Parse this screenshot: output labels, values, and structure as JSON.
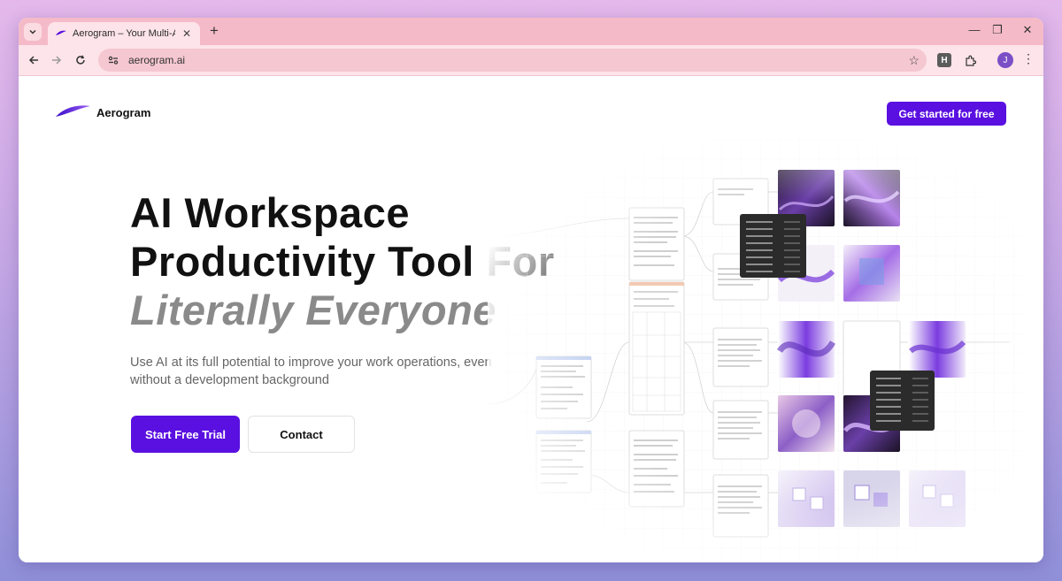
{
  "browser": {
    "tab_title": "Aerogram – Your Multi-AI-Mod",
    "url": "aerogram.ai",
    "extension_label": "H",
    "profile_initial": "J"
  },
  "header": {
    "logo_text": "Aerogram",
    "cta_label": "Get started for free"
  },
  "hero": {
    "title_line1": "AI Workspace",
    "title_line2": "Productivity Tool For",
    "title_line3": "Literally Everyone",
    "subtitle": "Use AI at its full potential to improve your work operations, even without a development background",
    "primary_cta": "Start Free Trial",
    "secondary_cta": "Contact"
  },
  "colors": {
    "brand": "#5a10e0",
    "tab_strip": "#f5bac8",
    "toolbar": "#fde4ea"
  },
  "icons": [
    "tab-menu-icon",
    "tab-favicon",
    "close-icon",
    "plus-icon",
    "minimize-icon",
    "restore-icon",
    "back-icon",
    "forward-icon",
    "reload-icon",
    "site-info-icon",
    "star-icon",
    "extensions-icon",
    "kebab-icon"
  ]
}
